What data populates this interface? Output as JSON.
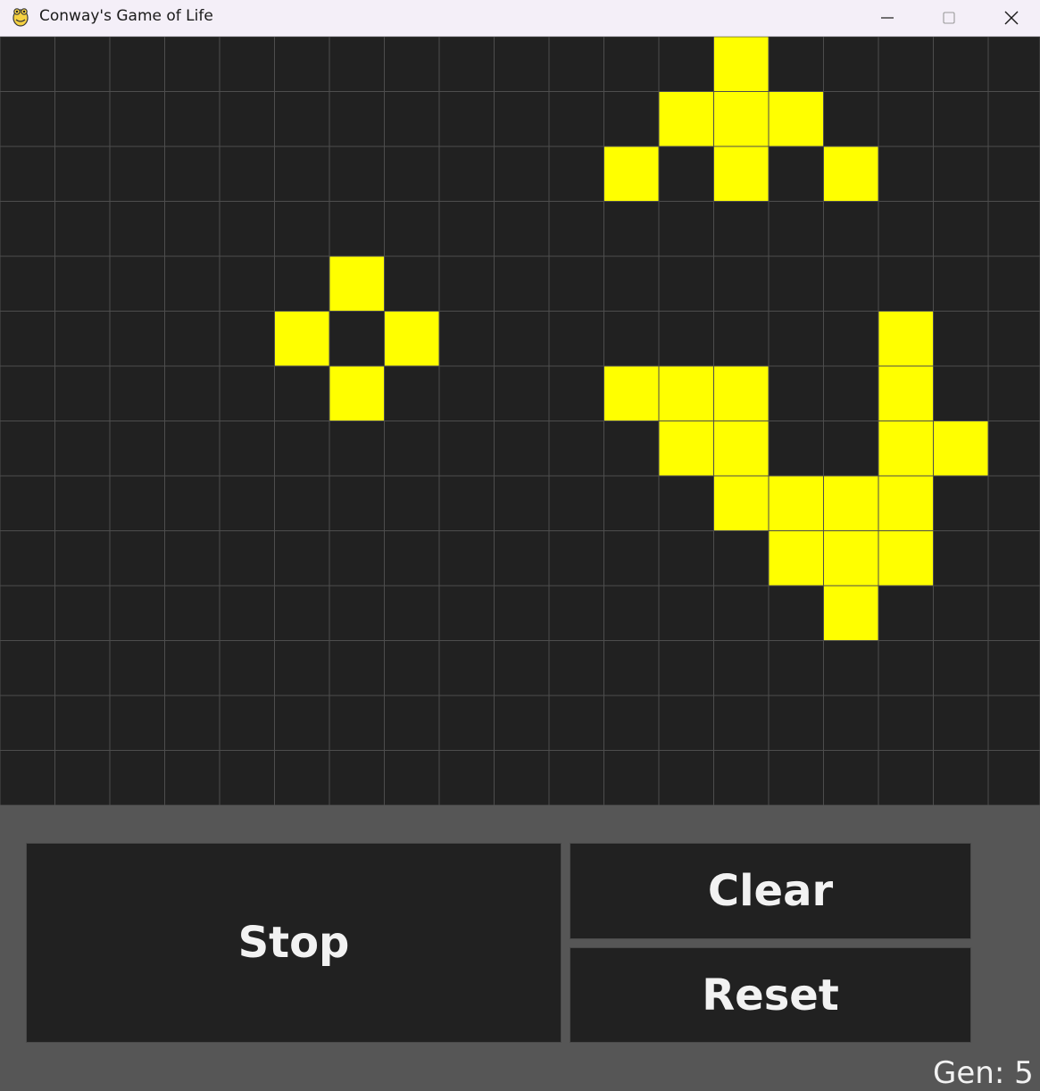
{
  "window": {
    "title": "Conway's Game of Life",
    "app_icon": "pygame-snake-icon"
  },
  "window_controls": {
    "minimize_icon": "minimize-icon",
    "maximize_icon": "maximize-icon",
    "close_icon": "close-icon"
  },
  "grid": {
    "columns": 19,
    "rows": 14,
    "live_color": "#ffff00",
    "dead_color": "#212121",
    "line_color": "#4d4d4d",
    "live_cells": [
      [
        0,
        13
      ],
      [
        1,
        12
      ],
      [
        1,
        13
      ],
      [
        1,
        14
      ],
      [
        2,
        11
      ],
      [
        2,
        13
      ],
      [
        2,
        15
      ],
      [
        4,
        6
      ],
      [
        5,
        5
      ],
      [
        5,
        7
      ],
      [
        5,
        16
      ],
      [
        6,
        6
      ],
      [
        6,
        11
      ],
      [
        6,
        12
      ],
      [
        6,
        13
      ],
      [
        6,
        16
      ],
      [
        7,
        12
      ],
      [
        7,
        13
      ],
      [
        7,
        16
      ],
      [
        7,
        17
      ],
      [
        8,
        13
      ],
      [
        8,
        14
      ],
      [
        8,
        15
      ],
      [
        8,
        16
      ],
      [
        9,
        14
      ],
      [
        9,
        15
      ],
      [
        9,
        16
      ],
      [
        10,
        15
      ]
    ]
  },
  "controls": {
    "stop_label": "Stop",
    "clear_label": "Clear",
    "reset_label": "Reset"
  },
  "status": {
    "generation_text": "Gen: 5"
  }
}
